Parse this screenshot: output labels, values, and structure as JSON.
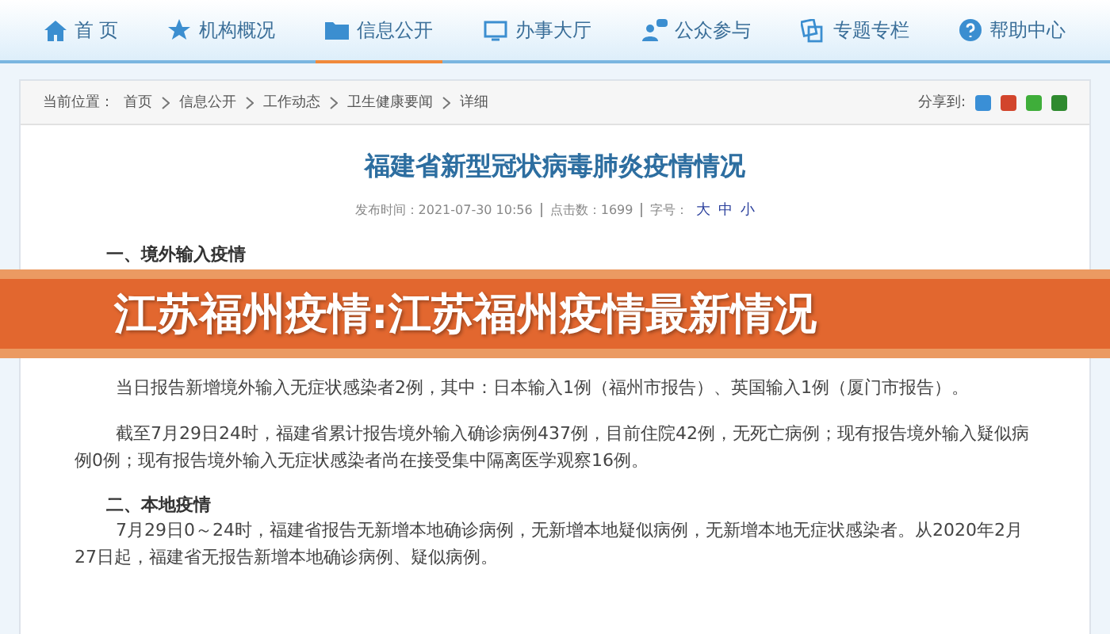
{
  "nav": [
    {
      "label": "首 页",
      "selected": false
    },
    {
      "label": "机构概况",
      "selected": false
    },
    {
      "label": "信息公开",
      "selected": true
    },
    {
      "label": "办事大厅",
      "selected": false
    },
    {
      "label": "公众参与",
      "selected": false
    },
    {
      "label": "专题专栏",
      "selected": false
    },
    {
      "label": "帮助中心",
      "selected": false
    }
  ],
  "breadcrumb": {
    "prefix": "当前位置：",
    "items": [
      "首页",
      "信息公开",
      "工作动态",
      "卫生健康要闻",
      "详细"
    ]
  },
  "share": {
    "label": "分享到:",
    "services": [
      {
        "color": "#3a8fd6"
      },
      {
        "color": "#d2452c"
      },
      {
        "color": "#3fae3a"
      },
      {
        "color": "#2f8a2f"
      }
    ]
  },
  "article": {
    "title": "福建省新型冠状病毒肺炎疫情情况",
    "meta": [
      {
        "label": "发布时间：",
        "value": "2021-07-30 10:56"
      },
      {
        "label": "点击数：",
        "value": "1699"
      }
    ],
    "font_label": "字号：",
    "font_sizes": [
      "大",
      "中",
      "小"
    ],
    "blocks": [
      {
        "kind": "heading",
        "text": "一、境外输入疫情"
      },
      {
        "kind": "hidden"
      },
      {
        "kind": "para",
        "text": "当日报告新增境外输入无症状感染者2例，其中：日本输入1例（福州市报告）、英国输入1例（厦门市报告）。"
      },
      {
        "kind": "para",
        "text": "截至7月29日24时，福建省累计报告境外输入确诊病例437例，目前住院42例，无死亡病例；现有报告境外输入疑似病例0例；现有报告境外输入无症状感染者尚在接受集中隔离医学观察16例。"
      },
      {
        "kind": "heading",
        "text": "二、本地疫情"
      },
      {
        "kind": "para",
        "text": "7月29日0～24时，福建省报告无新增本地确诊病例，无新增本地疑似病例，无新增本地无症状感染者。从2020年2月27日起，福建省无报告新增本地确诊病例、疑似病例。"
      }
    ]
  },
  "banner": {
    "text": "江苏福州疫情:江苏福州疫情最新情况"
  }
}
